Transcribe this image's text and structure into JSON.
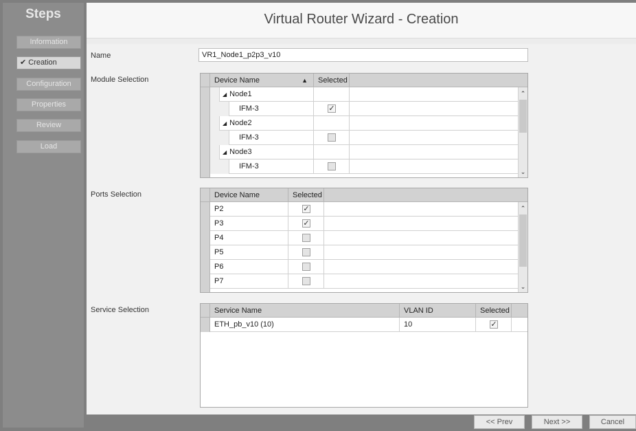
{
  "sidebar": {
    "title": "Steps",
    "items": [
      {
        "label": "Information",
        "active": false
      },
      {
        "label": "Creation",
        "active": true
      },
      {
        "label": "Configuration",
        "active": false
      },
      {
        "label": "Properties",
        "active": false
      },
      {
        "label": "Review",
        "active": false
      },
      {
        "label": "Load",
        "active": false
      }
    ],
    "check_glyph": "✔"
  },
  "header": {
    "title": "Virtual Router Wizard - Creation"
  },
  "form": {
    "name_label": "Name",
    "name_value": "VR1_Node1_p2p3_v10",
    "module_label": "Module Selection",
    "ports_label": "Ports Selection",
    "service_label": "Service Selection"
  },
  "module_grid": {
    "col_device": "Device Name",
    "col_selected": "Selected",
    "sort_indicator": "▲",
    "rows": [
      {
        "name": "Node1",
        "group": true,
        "selected": null
      },
      {
        "name": "IFM-3",
        "group": false,
        "selected": true
      },
      {
        "name": "Node2",
        "group": true,
        "selected": null
      },
      {
        "name": "IFM-3",
        "group": false,
        "selected": false
      },
      {
        "name": "Node3",
        "group": true,
        "selected": null
      },
      {
        "name": "IFM-3",
        "group": false,
        "selected": false
      }
    ]
  },
  "ports_grid": {
    "col_device": "Device Name",
    "col_selected": "Selected",
    "rows": [
      {
        "name": "P2",
        "selected": true
      },
      {
        "name": "P3",
        "selected": true
      },
      {
        "name": "P4",
        "selected": false
      },
      {
        "name": "P5",
        "selected": false
      },
      {
        "name": "P6",
        "selected": false
      },
      {
        "name": "P7",
        "selected": false
      }
    ]
  },
  "service_grid": {
    "col_service": "Service Name",
    "col_vlan": "VLAN ID",
    "col_selected": "Selected",
    "rows": [
      {
        "name": "ETH_pb_v10 (10)",
        "vlan": "10",
        "selected": true
      }
    ]
  },
  "footer": {
    "prev_label": "<< Prev",
    "next_label": "Next >>",
    "cancel_label": "Cancel"
  }
}
